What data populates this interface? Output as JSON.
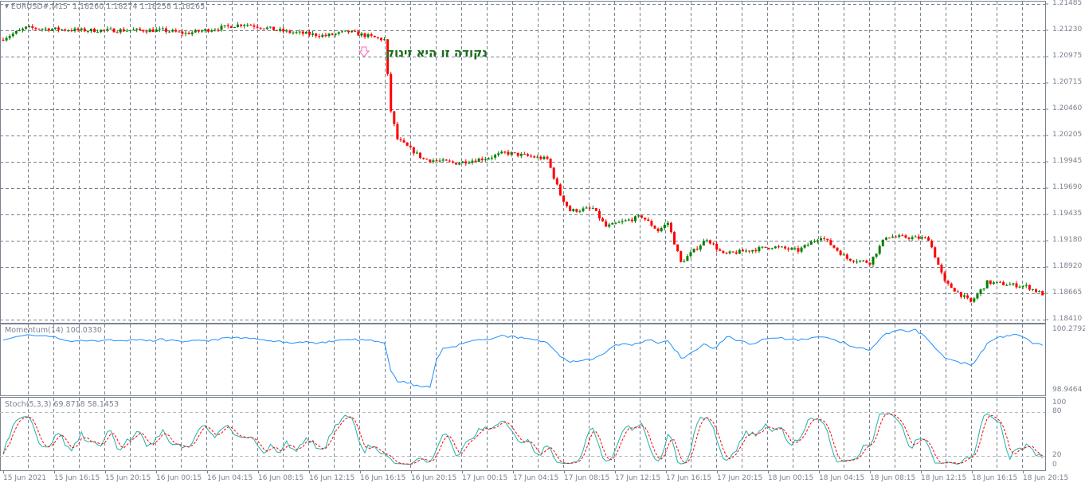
{
  "header": {
    "symbol": "EURUSD#,M15",
    "open": "1.18260",
    "high": "1.18274",
    "low": "1.18258",
    "close": "1.18265"
  },
  "annotation": {
    "text": "נקודה זו היא זינוק",
    "arrow_icon": "down-arrow"
  },
  "price_axis": [
    "1.21485",
    "1.21230",
    "1.20975",
    "1.20715",
    "1.20460",
    "1.20205",
    "1.19945",
    "1.19690",
    "1.19435",
    "1.19180",
    "1.18920",
    "1.18665",
    "1.18410"
  ],
  "momentum": {
    "title": "Momentum(14) 100.0330",
    "max": "100.2792",
    "min": "98.9464"
  },
  "stoch": {
    "title": "Stoch(5,3,3) 69.8718 58.1453",
    "levels": [
      "100",
      "80",
      "20",
      "0"
    ]
  },
  "time_axis": [
    "15 Jun 2021",
    "15 Jun 16:15",
    "15 Jun 20:15",
    "16 Jun 00:15",
    "16 Jun 04:15",
    "16 Jun 08:15",
    "16 Jun 12:15",
    "16 Jun 16:15",
    "16 Jun 20:15",
    "17 Jun 00:15",
    "17 Jun 04:15",
    "17 Jun 08:15",
    "17 Jun 12:15",
    "17 Jun 16:15",
    "17 Jun 20:15",
    "18 Jun 00:15",
    "18 Jun 04:15",
    "18 Jun 08:15",
    "18 Jun 12:15",
    "18 Jun 16:15",
    "18 Jun 20:15"
  ],
  "colors": {
    "up": "#008000",
    "down": "#ff0000",
    "momentum": "#1e90ff",
    "stoch_main": "#20b2aa",
    "stoch_signal": "#ff0000",
    "grid": "#7a8290"
  },
  "chart_data": {
    "type": "candlestick",
    "candles": 320,
    "price_range": [
      1.1841,
      1.21485
    ],
    "anchors": [
      [
        0,
        1.21136
      ],
      [
        8,
        1.21252
      ],
      [
        25,
        1.21229
      ],
      [
        50,
        1.21229
      ],
      [
        57,
        1.21198
      ],
      [
        75,
        1.21291
      ],
      [
        88,
        1.21214
      ],
      [
        100,
        1.21175
      ],
      [
        107,
        1.21214
      ],
      [
        118,
        1.21136
      ],
      [
        120,
        1.20439
      ],
      [
        122,
        1.20168
      ],
      [
        130,
        1.19974
      ],
      [
        140,
        1.19935
      ],
      [
        150,
        1.19989
      ],
      [
        155,
        1.20036
      ],
      [
        165,
        1.19989
      ],
      [
        168,
        1.19974
      ],
      [
        172,
        1.19625
      ],
      [
        175,
        1.1947
      ],
      [
        182,
        1.19493
      ],
      [
        186,
        1.19315
      ],
      [
        197,
        1.19416
      ],
      [
        202,
        1.19276
      ],
      [
        205,
        1.19354
      ],
      [
        209,
        1.18966
      ],
      [
        217,
        1.19199
      ],
      [
        222,
        1.19044
      ],
      [
        237,
        1.19121
      ],
      [
        245,
        1.19083
      ],
      [
        252,
        1.19222
      ],
      [
        260,
        1.19005
      ],
      [
        267,
        1.18966
      ],
      [
        272,
        1.19222
      ],
      [
        285,
        1.19199
      ],
      [
        290,
        1.18773
      ],
      [
        298,
        1.18579
      ],
      [
        303,
        1.18773
      ],
      [
        315,
        1.18734
      ],
      [
        320,
        1.1866
      ],
      [
        323,
        1.18734
      ]
    ]
  }
}
